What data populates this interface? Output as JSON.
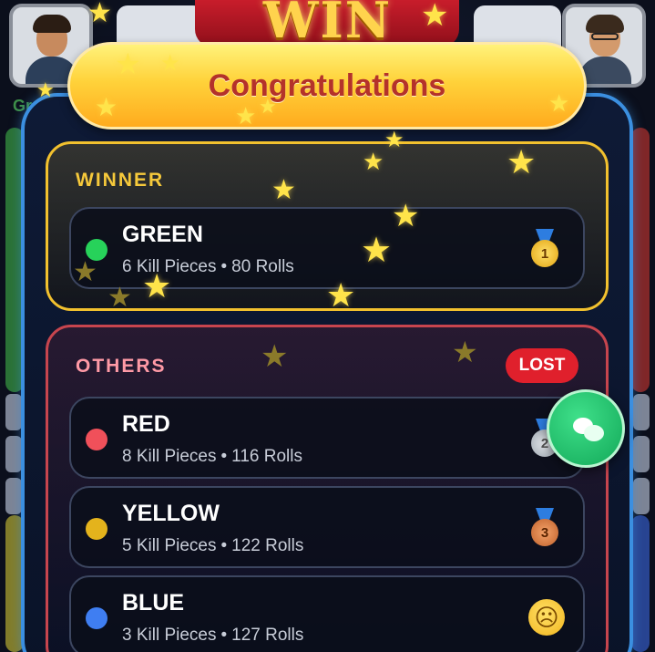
{
  "header": {
    "win_text": "WIN",
    "edge_label": "Gr",
    "title": "Congratulations"
  },
  "winner_section": {
    "title": "WINNER",
    "player": {
      "name": "GREEN",
      "kills": "6 Kill Pieces",
      "rolls": "80 Rolls",
      "color": "#27d25a",
      "rank": "1"
    }
  },
  "others_section": {
    "title": "OTHERS",
    "badge": "LOST",
    "players": [
      {
        "name": "RED",
        "kills": "8 Kill Pieces",
        "rolls": "116 Rolls",
        "color": "#f0505a",
        "rank": "2"
      },
      {
        "name": "YELLOW",
        "kills": "5 Kill Pieces",
        "rolls": "122 Rolls",
        "color": "#e4b31c",
        "rank": "3"
      },
      {
        "name": "BLUE",
        "kills": "3 Kill Pieces",
        "rolls": "127 Rolls",
        "color": "#3f7ef2",
        "rank": ""
      }
    ]
  },
  "separator": "•",
  "colors": {
    "panel_border": "#3b8fe0",
    "winner_border": "#f2c12e",
    "others_border": "#c7454e",
    "lost_badge": "#e0202c",
    "chat_button": "#1fc46a"
  },
  "icons": {
    "winner_emblem": "gold-medal-icon",
    "red_emblem": "silver-medal-icon",
    "yellow_emblem": "bronze-medal-icon",
    "blue_emblem": "crying-face-icon",
    "chat": "chat-bubbles-icon",
    "confetti": "star-icon"
  }
}
